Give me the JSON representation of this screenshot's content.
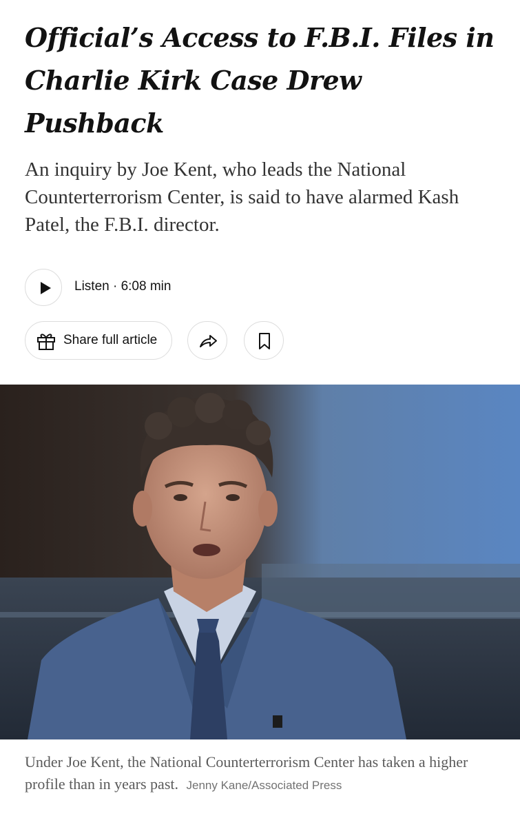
{
  "article": {
    "headline": "Official’s Access to F.B.I. Files in Charlie Kirk Case Drew Pushback",
    "summary": "An inquiry by Joe Kent, who leads the National Counterterrorism Center, is said to have alarmed Kash Patel, the F.B.I. director."
  },
  "listen": {
    "label": "Listen · 6:08 min",
    "icon": "play-icon"
  },
  "actions": {
    "share_label": "Share full article",
    "share_icon": "gift-icon",
    "forward_icon": "share-arrow-icon",
    "save_icon": "bookmark-icon"
  },
  "photo": {
    "caption": "Under Joe Kent, the National Counterterrorism Center has taken a higher profile than in years past.",
    "credit": "Jenny Kane/Associated Press"
  }
}
